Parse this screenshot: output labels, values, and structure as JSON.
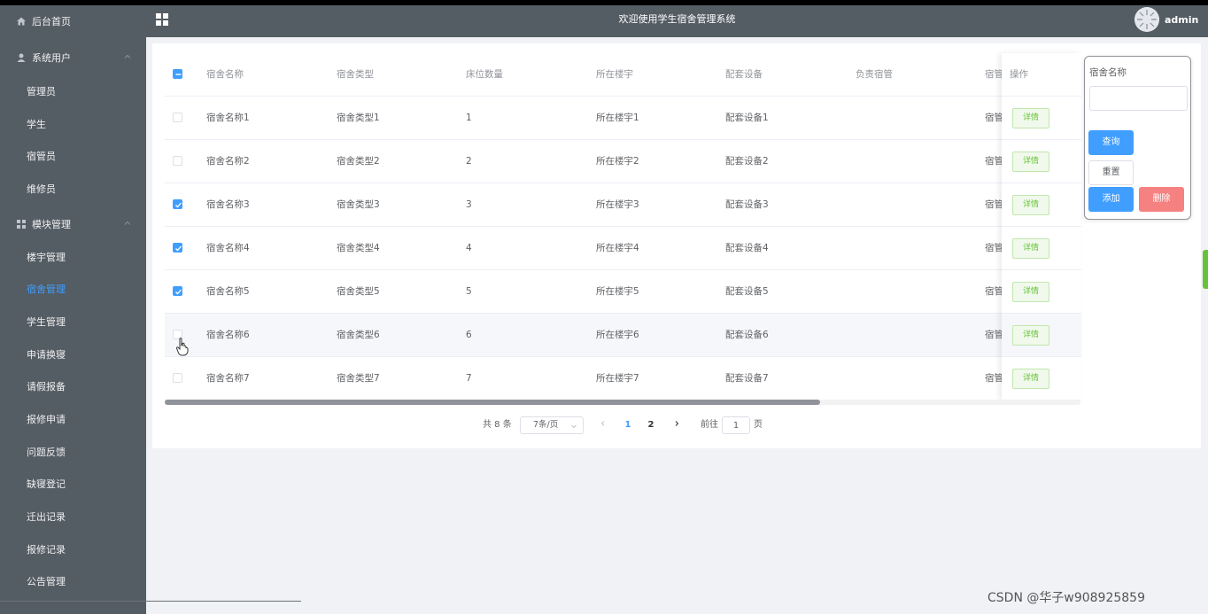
{
  "header": {
    "title": "欢迎使用学生宿舍管理系统",
    "user": "admin"
  },
  "sidebar": {
    "home": "后台首页",
    "group_users": "系统用户",
    "users": [
      "管理员",
      "学生",
      "宿管员",
      "维修员"
    ],
    "group_modules": "模块管理",
    "modules": [
      "楼宇管理",
      "宿舍管理",
      "学生管理",
      "申请换寝",
      "请假报备",
      "报修申请",
      "问题反馈",
      "缺寝登记",
      "迁出记录",
      "报修记录",
      "公告管理"
    ],
    "active_module": "宿舍管理"
  },
  "table": {
    "columns": [
      "宿舍名称",
      "宿舍类型",
      "床位数量",
      "所在楼宇",
      "配套设备",
      "负责宿管",
      "宿管"
    ],
    "action_column": "操作",
    "detail_label": "详情",
    "rows": [
      {
        "name": "宿舍名称1",
        "type": "宿舍类型1",
        "beds": "1",
        "building": "所在楼宇1",
        "equipment": "配套设备1",
        "manager": "",
        "extra": "宿管",
        "checked": false
      },
      {
        "name": "宿舍名称2",
        "type": "宿舍类型2",
        "beds": "2",
        "building": "所在楼宇2",
        "equipment": "配套设备2",
        "manager": "",
        "extra": "宿管",
        "checked": false
      },
      {
        "name": "宿舍名称3",
        "type": "宿舍类型3",
        "beds": "3",
        "building": "所在楼宇3",
        "equipment": "配套设备3",
        "manager": "",
        "extra": "宿管",
        "checked": true
      },
      {
        "name": "宿舍名称4",
        "type": "宿舍类型4",
        "beds": "4",
        "building": "所在楼宇4",
        "equipment": "配套设备4",
        "manager": "",
        "extra": "宿管",
        "checked": true
      },
      {
        "name": "宿舍名称5",
        "type": "宿舍类型5",
        "beds": "5",
        "building": "所在楼宇5",
        "equipment": "配套设备5",
        "manager": "",
        "extra": "宿管",
        "checked": true
      },
      {
        "name": "宿舍名称6",
        "type": "宿舍类型6",
        "beds": "6",
        "building": "所在楼宇6",
        "equipment": "配套设备6",
        "manager": "",
        "extra": "宿管",
        "checked": false
      },
      {
        "name": "宿舍名称7",
        "type": "宿舍类型7",
        "beds": "7",
        "building": "所在楼宇7",
        "equipment": "配套设备7",
        "manager": "",
        "extra": "宿管",
        "checked": false
      }
    ]
  },
  "pagination": {
    "total": "共 8 条",
    "page_size": "7条/页",
    "pages": [
      "1",
      "2"
    ],
    "current_page": "1",
    "goto_prefix": "前往",
    "goto_value": "1",
    "goto_suffix": "页"
  },
  "search": {
    "label": "宿舍名称",
    "value": "",
    "query": "查询",
    "reset": "重置",
    "add": "添加",
    "delete": "删除"
  },
  "watermark": "CSDN @华子w908925859",
  "colors": {
    "sidebar_bg": "#545c64",
    "primary": "#409eff",
    "success": "#67c23a",
    "danger": "#f56c6c"
  }
}
